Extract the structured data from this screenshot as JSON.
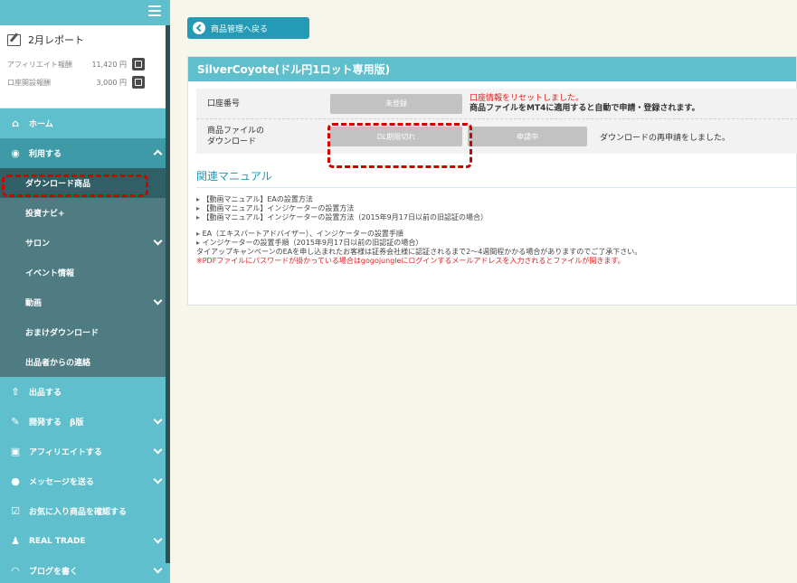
{
  "sidebar": {
    "report": {
      "title": "2月レポート",
      "rows": [
        {
          "label": "アフィリエイト報酬",
          "value": "11,420 円"
        },
        {
          "label": "口座開設報酬",
          "value": "3,000 円"
        }
      ]
    },
    "items": [
      {
        "label": "ホーム",
        "icon": "home-icon"
      },
      {
        "label": "利用する",
        "icon": "user-circle-icon"
      },
      {
        "label": "ダウンロード商品"
      },
      {
        "label": "投資ナビ+"
      },
      {
        "label": "サロン"
      },
      {
        "label": "イベント情報"
      },
      {
        "label": "動画"
      },
      {
        "label": "おまけダウンロード"
      },
      {
        "label": "出品者からの連絡"
      },
      {
        "label": "出品する",
        "icon": "upload-icon"
      },
      {
        "label": "開発する　β版",
        "icon": "wrench-icon"
      },
      {
        "label": "アフィリエイトする",
        "icon": "money-icon"
      },
      {
        "label": "メッセージを送る",
        "icon": "chat-icon"
      },
      {
        "label": "お気に入り商品を確認する",
        "icon": "checkbox-icon"
      },
      {
        "label": "REAL TRADE",
        "icon": "group-icon"
      },
      {
        "label": "ブログを書く",
        "icon": "rss-icon"
      }
    ]
  },
  "main": {
    "back_label": "商品管理へ戻る",
    "panel_title": "SilverCoyote(ドル円1ロット専用版)",
    "account_row": {
      "label": "口座番号",
      "button": "未登録",
      "msg_red": "口座情報をリセットしました。",
      "msg_bold": "商品ファイルをMT4に適用すると自動で申請・登録されます。"
    },
    "download_row": {
      "label_line1": "商品ファイルの",
      "label_line2": "ダウンロード",
      "button1": "DL期限切れ",
      "button2": "申請中",
      "msg": "ダウンロードの再申請をしました。"
    },
    "manual_title": "関連マニュアル",
    "manual_links": [
      "【動画マニュアル】EAの設置方法",
      "【動画マニュアル】インジケーターの設置方法",
      "【動画マニュアル】インジケーターの設置方法（2015年9月17日以前の旧認証の場合）"
    ],
    "manual_links2": [
      "EA（エキスパートアドバイザー）、インジケーターの設置手順",
      "インジケーターの設置手順（2015年9月17日以前の旧認証の場合）"
    ],
    "note": "タイアップキャンペーンのEAを申し込まれたお客様は証券会社様に認証されるまで2〜4週間程かかる場合がありますのでご了承下さい。",
    "warning": "※PDFファイルにパスワードが掛かっている場合はgogojungleにログインするメールアドレスを入力されるとファイルが開きます。"
  },
  "colors": {
    "accent": "#5fbfcc",
    "sidebar_dark": "#4f7b82",
    "button_blue": "#239ab6",
    "warning_red": "#e02020"
  }
}
